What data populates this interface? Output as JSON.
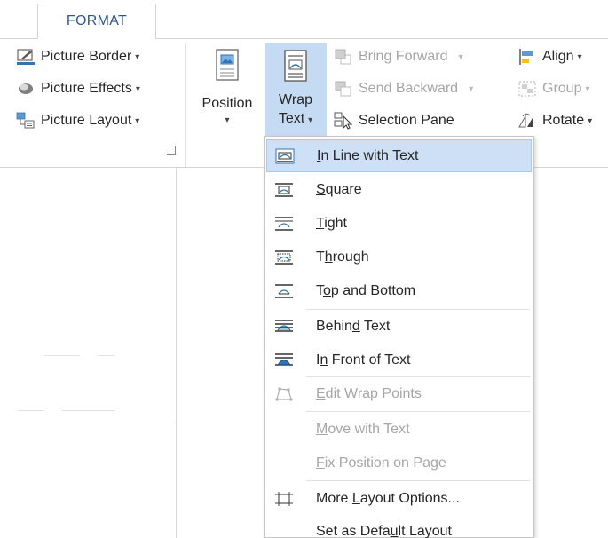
{
  "tabs": {
    "format": "FORMAT"
  },
  "picture_styles": {
    "border_label": "Picture Border",
    "effects_label": "Picture Effects",
    "layout_label": "Picture Layout"
  },
  "arrange": {
    "position_label": "Position",
    "wrap_line1": "Wrap",
    "wrap_line2": "Text",
    "bring_forward_label": "Bring Forward",
    "send_backward_label": "Send Backward",
    "selection_pane_label": "Selection Pane",
    "align_label": "Align",
    "group_label": "Group",
    "rotate_label": "Rotate"
  },
  "wrap_menu": {
    "inline": {
      "pre": "",
      "key": "I",
      "post": "n Line with Text"
    },
    "square": {
      "pre": "",
      "key": "S",
      "post": "quare"
    },
    "tight": {
      "pre": "",
      "key": "T",
      "post": "ight"
    },
    "through": {
      "pre": "T",
      "key": "h",
      "post": "rough"
    },
    "top_bottom": {
      "pre": "T",
      "key": "o",
      "post": "p and Bottom"
    },
    "behind": {
      "pre": "Behin",
      "key": "d",
      "post": " Text"
    },
    "front": {
      "pre": "I",
      "key": "n",
      "post": " Front of Text"
    },
    "edit_points": {
      "pre": "",
      "key": "E",
      "post": "dit Wrap Points"
    },
    "move_with": {
      "pre": "",
      "key": "M",
      "post": "ove with Text"
    },
    "fix_position": {
      "pre": "",
      "key": "F",
      "post": "ix Position on Page"
    },
    "more_layout": {
      "pre": "More ",
      "key": "L",
      "post": "ayout Options..."
    },
    "set_default": {
      "pre": "Set as Defa",
      "key": "u",
      "post": "lt Layout"
    }
  },
  "colors": {
    "accent": "#2b579a",
    "highlight": "#cde0f5",
    "wrap_button_active": "#c5daf3",
    "disabled_text": "#a6a6a6"
  },
  "icons": [
    "picture-border-icon",
    "picture-effects-icon",
    "picture-layout-icon",
    "position-icon",
    "wrap-text-icon",
    "bring-forward-icon",
    "send-backward-icon",
    "selection-pane-icon",
    "align-icon",
    "group-icon",
    "rotate-icon",
    "wrap-inline-icon",
    "wrap-square-icon",
    "wrap-tight-icon",
    "wrap-through-icon",
    "wrap-top-bottom-icon",
    "wrap-behind-icon",
    "wrap-front-icon",
    "edit-wrap-points-icon",
    "more-layout-options-icon"
  ]
}
